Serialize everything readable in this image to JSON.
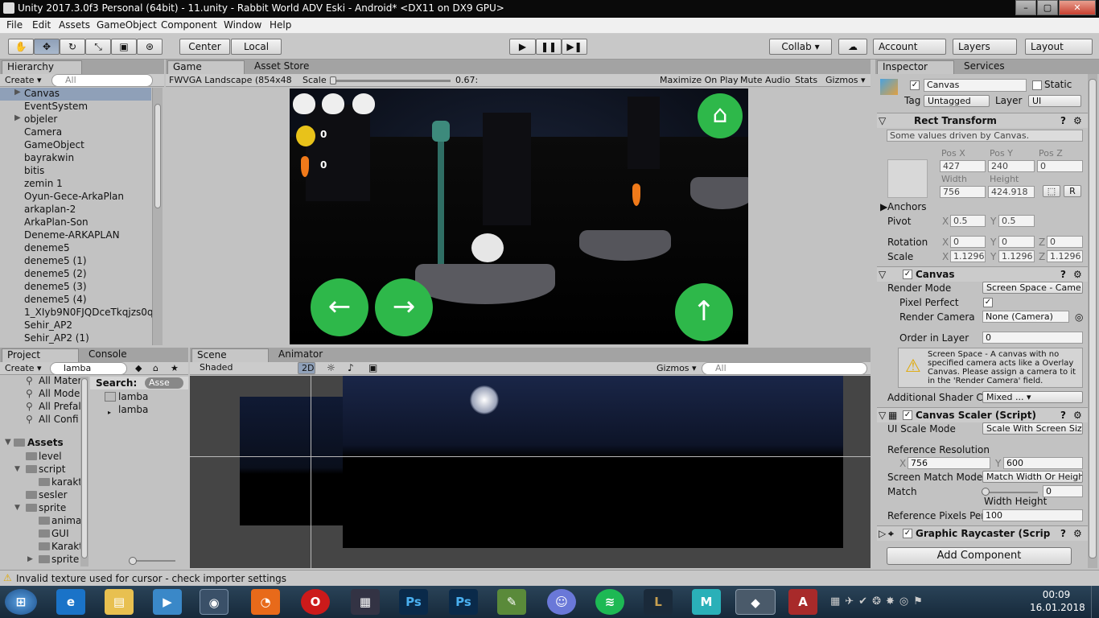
{
  "window": {
    "title": "Unity 2017.3.0f3 Personal (64bit) - 11.unity - Rabbit World ADV Eski - Android* <DX11 on DX9 GPU>"
  },
  "menu": [
    "File",
    "Edit",
    "Assets",
    "GameObject",
    "Component",
    "Window",
    "Help"
  ],
  "toolbar": {
    "center": "Center",
    "local": "Local",
    "collab": "Collab ▾",
    "account": "Account",
    "layers": "Layers",
    "layout": "Layout"
  },
  "hierarchy": {
    "tab": "Hierarchy",
    "create": "Create ▾",
    "search_placeholder": "All",
    "items": [
      "Canvas",
      "EventSystem",
      "objeler",
      "Camera",
      "GameObject",
      "bayrakwin",
      "bitis",
      "zemin 1",
      "Oyun-Gece-ArkaPlan",
      "arkaplan-2",
      "ArkaPlan-Son",
      "Deneme-ARKAPLAN",
      "deneme5",
      "deneme5 (1)",
      "deneme5 (2)",
      "deneme5 (3)",
      "deneme5 (4)",
      "1_XIyb9N0FJQDceTkqjzs0q",
      "Sehir_AP2",
      "Sehir_AP2 (1)"
    ]
  },
  "game": {
    "tab_game": "Game",
    "tab_store": "Asset Store",
    "resolution": "FWVGA Landscape (854x48",
    "scale_label": "Scale",
    "scale_value": "0.67:",
    "buttons": [
      "Maximize On Play",
      "Mute Audio",
      "Stats",
      "Gizmos ▾"
    ],
    "coin_count": "0",
    "carrot_count": "0"
  },
  "project": {
    "tab_project": "Project",
    "tab_console": "Console",
    "create": "Create ▾",
    "search": "lamba",
    "favorites": [
      "All Mater",
      "All Model",
      "All Prefal",
      "All Confi"
    ],
    "assets_label": "Assets",
    "tree": [
      "level",
      "script",
      "karakt",
      "sesler",
      "sprite",
      "anima",
      "GUI",
      "Karakt",
      "sprite"
    ],
    "search_label": "Search:",
    "search_scope": "Asse",
    "results": [
      "lamba",
      "lamba"
    ]
  },
  "scene": {
    "tab_scene": "Scene",
    "tab_animator": "Animator",
    "shading": "Shaded",
    "mode_2d": "2D",
    "gizmos": "Gizmos ▾",
    "search_placeholder": "All"
  },
  "inspector": {
    "tab": "Inspector",
    "tab2": "Services",
    "object_name": "Canvas",
    "static": "Static",
    "tag_label": "Tag",
    "tag": "Untagged",
    "layer_label": "Layer",
    "layer": "UI",
    "rect": {
      "title": "Rect Transform",
      "note": "Some values driven by Canvas.",
      "pos_x_label": "Pos X",
      "pos_y_label": "Pos Y",
      "pos_z_label": "Pos Z",
      "pos_x": "427",
      "pos_y": "240",
      "pos_z": "0",
      "width_label": "Width",
      "height_label": "Height",
      "width": "756",
      "height": "424.918",
      "r": "R",
      "anchors": "Anchors",
      "pivot": "Pivot",
      "pivot_x": "0.5",
      "pivot_y": "0.5",
      "rotation": "Rotation",
      "rot_x": "0",
      "rot_y": "0",
      "rot_z": "0",
      "scale": "Scale",
      "scale_x": "1.1296",
      "scale_y": "1.1296",
      "scale_z": "1.1296"
    },
    "canvas": {
      "title": "Canvas",
      "render_mode_label": "Render Mode",
      "render_mode": "Screen Space - Came ▾",
      "pixel_perfect": "Pixel Perfect",
      "render_camera_label": "Render Camera",
      "render_camera": "None (Camera)",
      "order_label": "Order in Layer",
      "order": "0",
      "warning": "Screen Space - A canvas with no specified camera acts like a Overlay Canvas. Please assign a camera to it in the 'Render Camera' field.",
      "shader_label": "Additional Shader Cl",
      "shader": "Mixed ... ▾"
    },
    "scaler": {
      "title": "Canvas Scaler (Script)",
      "ui_scale_label": "UI Scale Mode",
      "ui_scale": "Scale With Screen Siz ▾",
      "ref_res_label": "Reference Resolution",
      "ref_x": "756",
      "ref_y": "600",
      "match_mode_label": "Screen Match Mode",
      "match_mode": "Match Width Or Heigh ▾",
      "match_label": "Match",
      "match": "0",
      "match_caption": "Width Height",
      "ppu_label": "Reference Pixels Per",
      "ppu": "100"
    },
    "raycaster": {
      "title": "Graphic Raycaster (Scrip"
    },
    "add_component": "Add Component"
  },
  "status": {
    "message": "Invalid texture used for cursor - check importer settings"
  },
  "taskbar": {
    "time": "00:09",
    "date": "16.01.2018"
  },
  "colors": {
    "game_green": "#2eb84a",
    "title_bar": "#0a0a0a",
    "accent_select": "#8fa0b8"
  }
}
